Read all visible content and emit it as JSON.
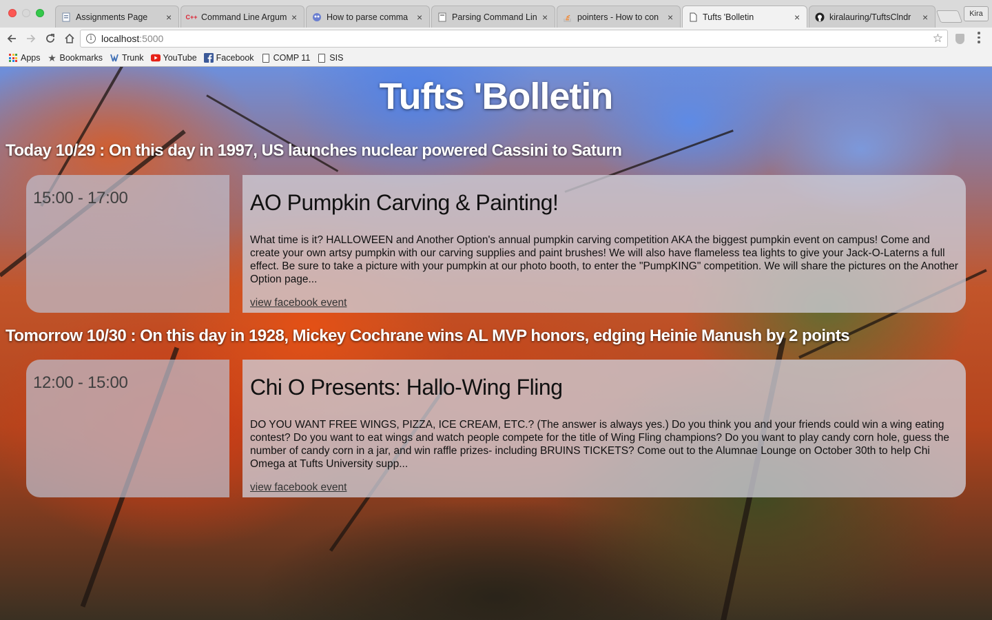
{
  "browser": {
    "tabs": [
      {
        "title": "Assignments Page",
        "favicon": "page-icon",
        "active": false
      },
      {
        "title": "Command Line Argum",
        "favicon": "cplusplus-icon",
        "active": false
      },
      {
        "title": "How to parse comma",
        "favicon": "site-icon",
        "active": false
      },
      {
        "title": "Parsing Command Lin",
        "favicon": "document-icon",
        "active": false
      },
      {
        "title": "pointers - How to con",
        "favicon": "stackoverflow-icon",
        "active": false
      },
      {
        "title": "Tufts 'Bolletin",
        "favicon": "page-icon",
        "active": true
      },
      {
        "title": "kiralauring/TuftsClndr",
        "favicon": "github-icon",
        "active": false
      }
    ],
    "profile_name": "Kira",
    "url_host": "localhost",
    "url_port": ":5000",
    "bookmarks": [
      {
        "label": "Apps",
        "icon": "apps-grid-icon"
      },
      {
        "label": "Bookmarks",
        "icon": "star-icon"
      },
      {
        "label": "Trunk",
        "icon": "trunk-icon"
      },
      {
        "label": "YouTube",
        "icon": "youtube-icon"
      },
      {
        "label": "Facebook",
        "icon": "facebook-icon"
      },
      {
        "label": "COMP 11",
        "icon": "document-icon"
      },
      {
        "label": "SIS",
        "icon": "document-icon"
      }
    ]
  },
  "page": {
    "title": "Tufts 'Bolletin",
    "days": [
      {
        "heading": "Today 10/29 : On this day in 1997, US launches nuclear powered Cassini to Saturn",
        "events": [
          {
            "time": "15:00 - 17:00",
            "title": "AO Pumpkin Carving & Painting!",
            "description": "What time is it? HALLOWEEN and Another Option's annual pumpkin carving competition AKA the biggest pumpkin event on campus! Come and create your own artsy pumpkin with our carving supplies and paint brushes! We will also have flameless tea lights to give your Jack-O-Laterns a full effect. Be sure to take a picture with your pumpkin at our photo booth, to enter the \"PumpKING\" competition. We will share the pictures on the Another Option page...",
            "link_label": "view facebook event"
          }
        ]
      },
      {
        "heading": "Tomorrow 10/30 : On this day in 1928, Mickey Cochrane wins AL MVP honors, edging Heinie Manush by 2 points",
        "events": [
          {
            "time": "12:00 - 15:00",
            "title": "Chi O Presents: Hallo-Wing Fling",
            "description": "DO YOU WANT FREE WINGS, PIZZA, ICE CREAM, ETC.? (The answer is always yes.) Do you think you and your friends could win a wing eating contest? Do you want to eat wings and watch people compete for the title of Wing Fling champions? Do you want to play candy corn hole, guess the number of candy corn in a jar, and win raffle prizes- including BRUINS TICKETS? Come out to the Alumnae Lounge on October 30th to help Chi Omega at Tufts University supp...",
            "link_label": "view facebook event"
          }
        ]
      }
    ]
  },
  "colors": {
    "traffic_red": "#fc5753",
    "traffic_green": "#34c84a",
    "youtube_red": "#e62117",
    "facebook_blue": "#3b5998"
  }
}
